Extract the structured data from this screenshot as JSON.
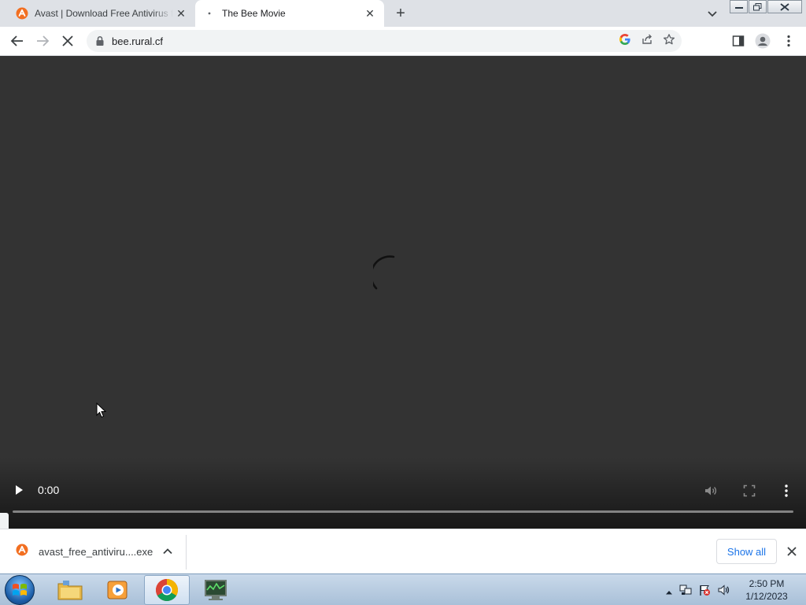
{
  "browser": {
    "tabs": [
      {
        "title": "Avast | Download Free Antivirus f",
        "favicon": "avast-icon",
        "active": false
      },
      {
        "title": "The Bee Movie",
        "favicon": "loading-dot-icon",
        "active": true
      }
    ],
    "url": "bee.rural.cf"
  },
  "video": {
    "current_time": "0:00",
    "progress": 0
  },
  "downloads": {
    "file_name": "avast_free_antiviru....exe",
    "show_all_label": "Show all"
  },
  "taskbar": {
    "apps": [
      "file-explorer",
      "media-player",
      "chrome",
      "network-monitor"
    ],
    "time": "2:50 PM",
    "date": "1/12/2023"
  },
  "colors": {
    "avast_orange": "#f26f21",
    "link_blue": "#1a73e8",
    "page_bg": "#333333"
  }
}
